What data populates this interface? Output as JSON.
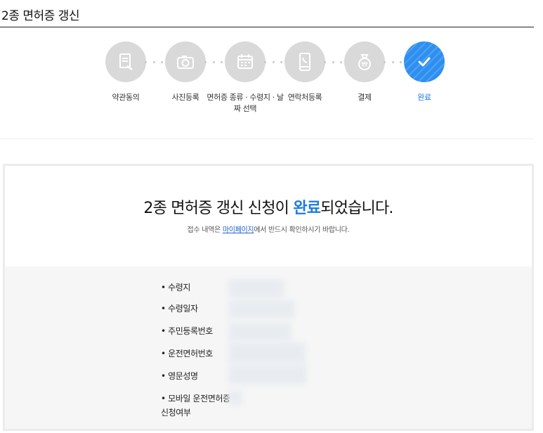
{
  "page": {
    "title": "2종 면허증 갱신"
  },
  "steps": [
    {
      "label": "약관동의",
      "icon": "document-icon",
      "state": "done"
    },
    {
      "label": "사진등록",
      "icon": "camera-icon",
      "state": "done"
    },
    {
      "label": "면허증 종류 · 수령지 · 날짜 선택",
      "icon": "calendar-icon",
      "state": "done"
    },
    {
      "label": "연락처등록",
      "icon": "phone-icon",
      "state": "done"
    },
    {
      "label": "결제",
      "icon": "money-bag-icon",
      "state": "done"
    },
    {
      "label": "완료",
      "icon": "check-icon",
      "state": "active"
    }
  ],
  "result": {
    "headline_prefix": "2종 면허증 갱신 신청이 ",
    "headline_accent": "완료",
    "headline_suffix": "되었습니다.",
    "sub_prefix": "접수 내역은 ",
    "sub_link": "마이페이지",
    "sub_suffix": "에서 반드시 확인하시기 바랍니다."
  },
  "details": [
    "• 수령지",
    "• 수령일자",
    "• 주민등록번호",
    "• 운전면허번호",
    "• 영문성명",
    "• 모바일 운전면허증 신청여부"
  ],
  "colors": {
    "accent": "#1e7be0",
    "inactive_circle": "#d9d9d9",
    "panel_bg": "#f6f6f6"
  }
}
